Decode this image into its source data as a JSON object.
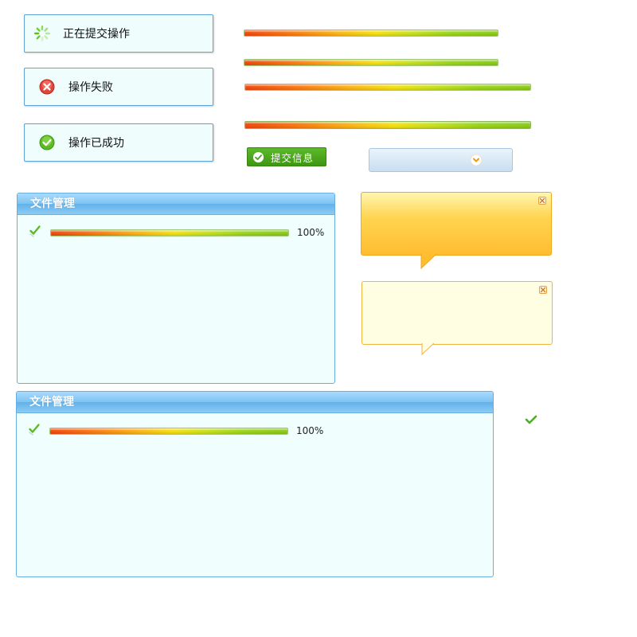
{
  "status_boxes": {
    "loading": {
      "text": "正在提交操作",
      "icon": "loading-spinner-icon"
    },
    "error": {
      "text": "操作失败",
      "icon": "error-x-icon"
    },
    "success": {
      "text": "操作已成功",
      "icon": "success-check-icon"
    }
  },
  "buttons": {
    "submit_label": "提交信息"
  },
  "panels": [
    {
      "title": "文件管理",
      "progress_label": "100%",
      "progress": 1.0
    },
    {
      "title": "文件管理",
      "progress_label": "100%",
      "progress": 1.0
    }
  ],
  "progress_bars": [
    1.0,
    1.0,
    1.0,
    1.0
  ],
  "colors": {
    "accent_blue": "#69aee0",
    "button_green": "#4aa41e",
    "tooltip_orange": "#ffbd30",
    "tooltip_yellow": "#fffde2"
  },
  "icons": {
    "dropdown": "chevron-down-icon",
    "tooltip_close": "close-icon",
    "standalone": "check-icon"
  }
}
